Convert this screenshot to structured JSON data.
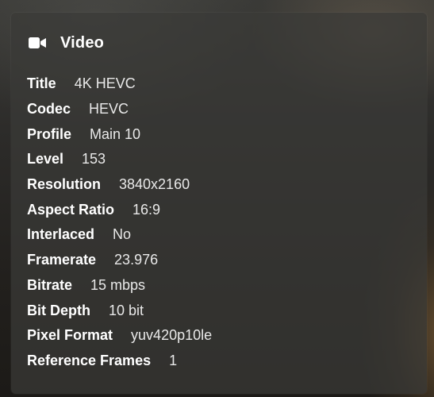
{
  "section": {
    "icon": "video-camera-icon",
    "title": "Video"
  },
  "rows": [
    {
      "label": "Title",
      "value": "4K HEVC"
    },
    {
      "label": "Codec",
      "value": "HEVC"
    },
    {
      "label": "Profile",
      "value": "Main 10"
    },
    {
      "label": "Level",
      "value": "153"
    },
    {
      "label": "Resolution",
      "value": "3840x2160"
    },
    {
      "label": "Aspect Ratio",
      "value": "16:9"
    },
    {
      "label": "Interlaced",
      "value": "No"
    },
    {
      "label": "Framerate",
      "value": "23.976"
    },
    {
      "label": "Bitrate",
      "value": "15 mbps"
    },
    {
      "label": "Bit Depth",
      "value": "10 bit"
    },
    {
      "label": "Pixel Format",
      "value": "yuv420p10le"
    },
    {
      "label": "Reference Frames",
      "value": "1"
    }
  ]
}
